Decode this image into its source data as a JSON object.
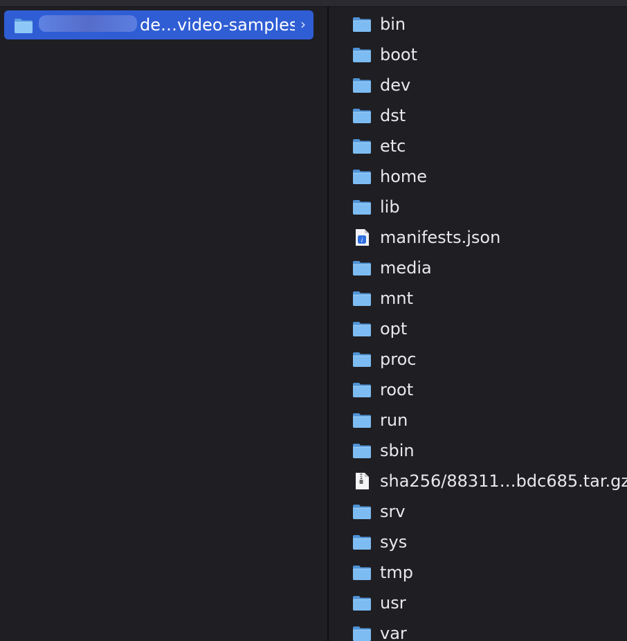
{
  "left_column": {
    "selected_item": {
      "label_visible": "de…video-samples",
      "icon": "folder-icon",
      "has_children": true,
      "chevron": "›"
    }
  },
  "right_column": {
    "items": [
      {
        "name": "bin",
        "icon": "folder-icon",
        "kind": "folder"
      },
      {
        "name": "boot",
        "icon": "folder-icon",
        "kind": "folder"
      },
      {
        "name": "dev",
        "icon": "folder-icon",
        "kind": "folder"
      },
      {
        "name": "dst",
        "icon": "folder-icon",
        "kind": "folder"
      },
      {
        "name": "etc",
        "icon": "folder-icon",
        "kind": "folder"
      },
      {
        "name": "home",
        "icon": "folder-icon",
        "kind": "folder"
      },
      {
        "name": "lib",
        "icon": "folder-icon",
        "kind": "folder"
      },
      {
        "name": "manifests.json",
        "icon": "json-file-icon",
        "kind": "json"
      },
      {
        "name": "media",
        "icon": "folder-icon",
        "kind": "folder"
      },
      {
        "name": "mnt",
        "icon": "folder-icon",
        "kind": "folder"
      },
      {
        "name": "opt",
        "icon": "folder-icon",
        "kind": "folder"
      },
      {
        "name": "proc",
        "icon": "folder-icon",
        "kind": "folder"
      },
      {
        "name": "root",
        "icon": "folder-icon",
        "kind": "folder"
      },
      {
        "name": "run",
        "icon": "folder-icon",
        "kind": "folder"
      },
      {
        "name": "sbin",
        "icon": "folder-icon",
        "kind": "folder"
      },
      {
        "name": "sha256/88311…bdc685.tar.gz",
        "icon": "archive-file-icon",
        "kind": "archive"
      },
      {
        "name": "srv",
        "icon": "folder-icon",
        "kind": "folder"
      },
      {
        "name": "sys",
        "icon": "folder-icon",
        "kind": "folder"
      },
      {
        "name": "tmp",
        "icon": "folder-icon",
        "kind": "folder"
      },
      {
        "name": "usr",
        "icon": "folder-icon",
        "kind": "folder"
      },
      {
        "name": "var",
        "icon": "folder-icon",
        "kind": "folder"
      }
    ]
  },
  "colors": {
    "background": "#1f1e23",
    "selection": "#2f5dd4",
    "folder_blue": "#6fb3f0",
    "text": "#e9e9eb",
    "divider": "#0e0d10"
  }
}
